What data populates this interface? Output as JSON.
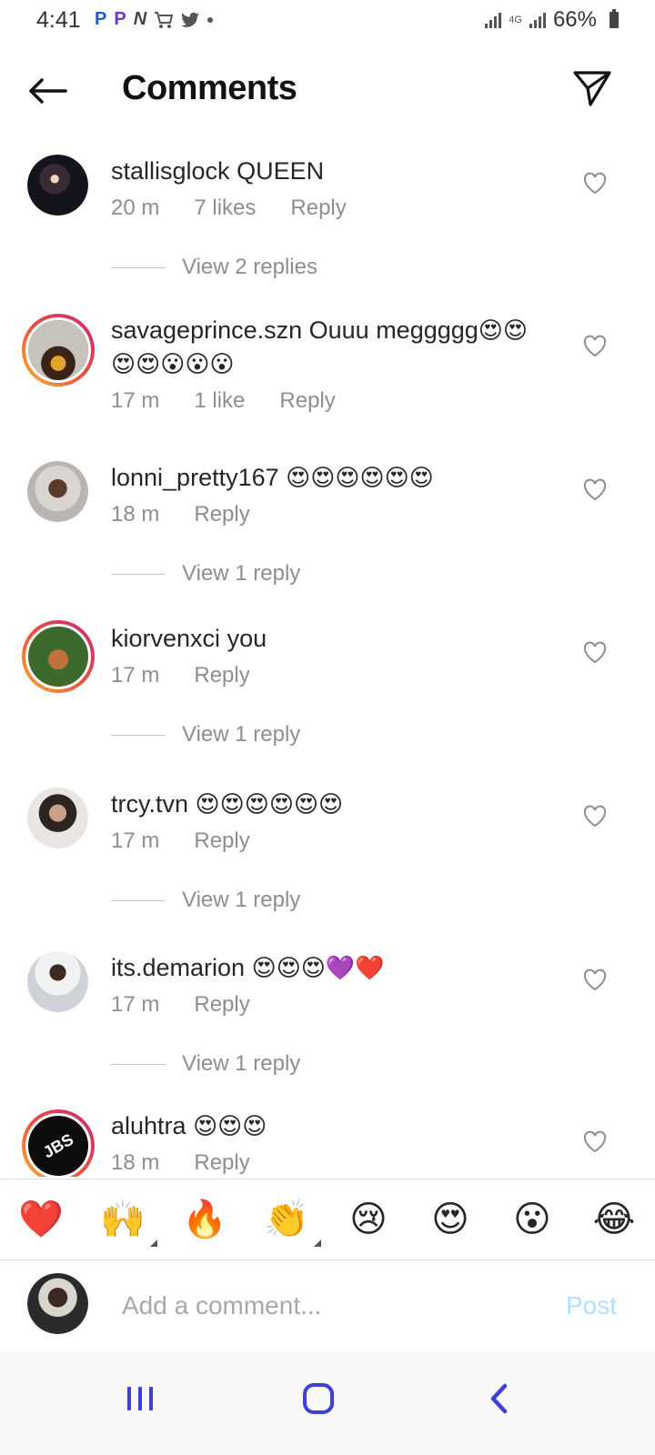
{
  "status_bar": {
    "time": "4:41",
    "notification_icons": [
      "P",
      "P",
      "N"
    ],
    "network": "4G",
    "battery": "66%"
  },
  "header": {
    "title": "Comments"
  },
  "comments": [
    {
      "username": "stallisglock",
      "text": "QUEEN",
      "emojis": "",
      "emojis_line2": "",
      "time": "20 m",
      "likes": "7 likes",
      "reply_label": "Reply",
      "view_replies": "View 2 replies",
      "avatar_ring": false
    },
    {
      "username": "savageprince.szn",
      "text": "Ouuu meggggg",
      "emojis": "😍😍",
      "emojis_line2": "😍😍😮😮😮",
      "time": "17 m",
      "likes": "1 like",
      "reply_label": "Reply",
      "view_replies": "",
      "avatar_ring": true
    },
    {
      "username": "lonni_pretty167",
      "text": "",
      "emojis": "😍😍😍😍😍😍",
      "emojis_line2": "",
      "time": "18 m",
      "likes": "",
      "reply_label": "Reply",
      "view_replies": "View 1 reply",
      "avatar_ring": false
    },
    {
      "username": "kiorvenxci",
      "text": "you",
      "emojis": "",
      "emojis_line2": "",
      "time": "17 m",
      "likes": "",
      "reply_label": "Reply",
      "view_replies": "View 1 reply",
      "avatar_ring": true
    },
    {
      "username": "trcy.tvn",
      "text": "",
      "emojis": "😍😍😍😍😍😍",
      "emojis_line2": "",
      "time": "17 m",
      "likes": "",
      "reply_label": "Reply",
      "view_replies": "View 1 reply",
      "avatar_ring": false
    },
    {
      "username": "its.demarion",
      "text": "",
      "emojis": "😍😍😍💜❤️",
      "emojis_line2": "",
      "time": "17 m",
      "likes": "",
      "reply_label": "Reply",
      "view_replies": "View 1 reply",
      "avatar_ring": false
    },
    {
      "username": "aluhtra",
      "text": "",
      "emojis": "😍😍😍",
      "emojis_line2": "",
      "time": "18 m",
      "likes": "",
      "reply_label": "Reply",
      "view_replies": "",
      "avatar_ring": true,
      "avatar_text": "JBS"
    }
  ],
  "reactions": [
    "❤️",
    "🙌",
    "🔥",
    "👏",
    "😢",
    "😍",
    "😮",
    "😂"
  ],
  "composer": {
    "placeholder": "Add a comment...",
    "post_label": "Post"
  },
  "colors": {
    "muted_text": "#8e8e8e",
    "post_disabled": "#b2dffc",
    "nav_accent": "#3d3fd6",
    "avatar_ring_gradient": [
      "#f9b233",
      "#e94e3c",
      "#c7287a"
    ]
  }
}
